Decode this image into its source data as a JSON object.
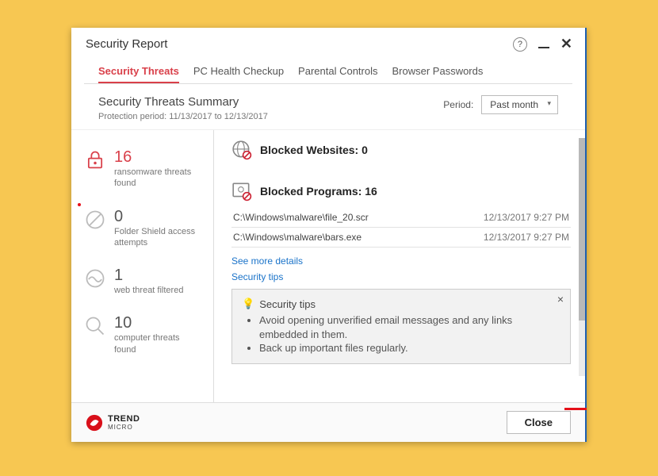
{
  "window": {
    "title": "Security Report"
  },
  "tabs": [
    {
      "label": "Security Threats",
      "active": true
    },
    {
      "label": "PC Health Checkup",
      "active": false
    },
    {
      "label": "Parental Controls",
      "active": false
    },
    {
      "label": "Browser Passwords",
      "active": false
    }
  ],
  "summary": {
    "title": "Security Threats Summary",
    "subtitle": "Protection period: 11/13/2017 to 12/13/2017",
    "period_label": "Period:",
    "period_selected": "Past month"
  },
  "stats": {
    "ransomware": {
      "count": "16",
      "label": "ransomware threats found"
    },
    "folder_shield": {
      "count": "0",
      "label": "Folder Shield access attempts"
    },
    "web_threat": {
      "count": "1",
      "label": "web threat filtered"
    },
    "computer_threats": {
      "count": "10",
      "label": "computer threats found"
    }
  },
  "blocked_websites": {
    "title": "Blocked Websites: 0"
  },
  "blocked_programs": {
    "title": "Blocked Programs: 16",
    "items": [
      {
        "path": "C:\\Windows\\malware\\file_20.scr",
        "time": "12/13/2017 9:27 PM"
      },
      {
        "path": "C:\\Windows\\malware\\bars.exe",
        "time": "12/13/2017 9:27 PM"
      }
    ]
  },
  "links": {
    "see_more": "See more details",
    "security_tips": "Security tips"
  },
  "tipbox": {
    "title": "Security tips",
    "tips": [
      "Avoid opening unverified email messages and any links embedded in them.",
      "Back up important files regularly."
    ]
  },
  "footer": {
    "close": "Close",
    "brand": "TREND",
    "brand_sub": "MICRO"
  }
}
